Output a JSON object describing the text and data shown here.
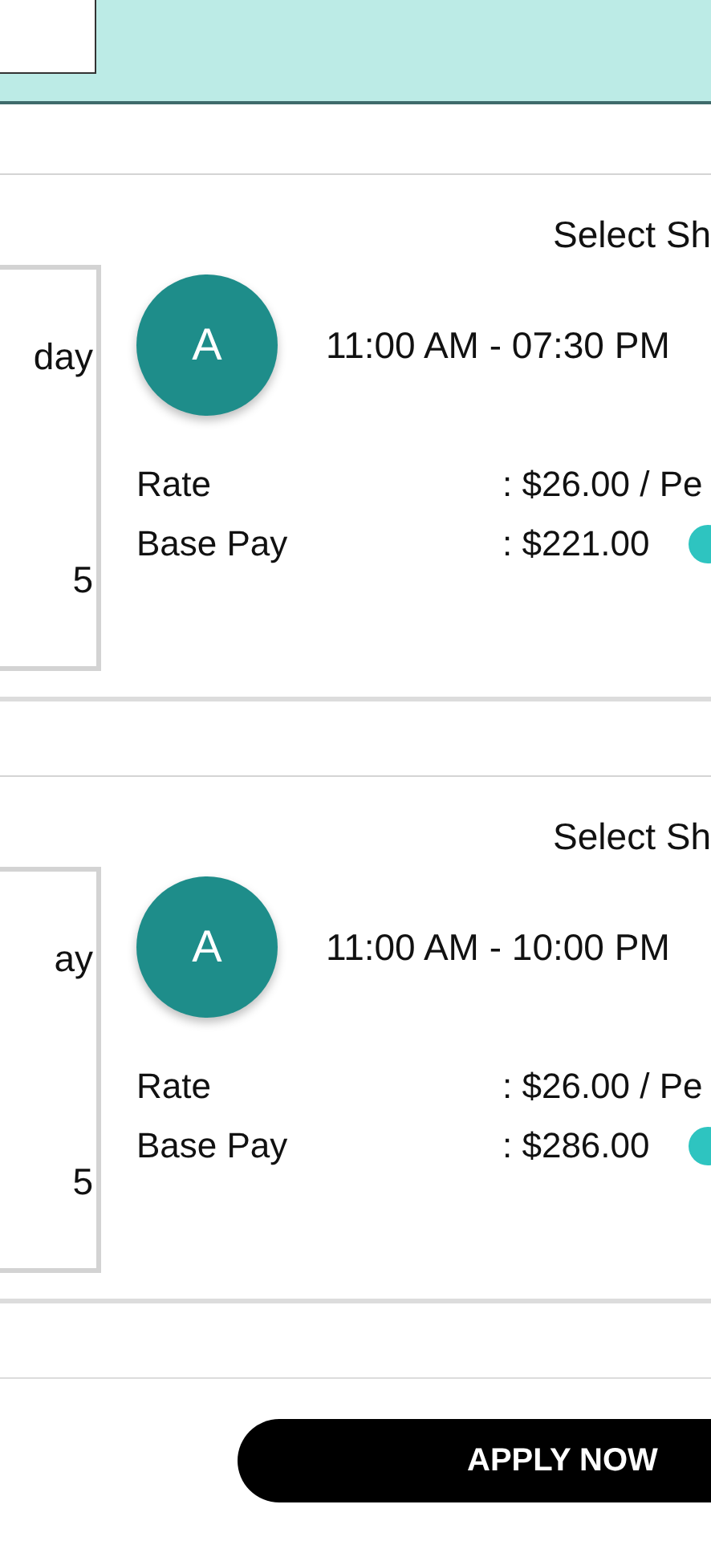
{
  "cards": [
    {
      "select_label": "Select Sh",
      "date_lines": [
        "day",
        "5"
      ],
      "avatar_letter": "A",
      "time_range": "11:00 AM - 07:30 PM",
      "details": [
        {
          "label": "Rate",
          "value": ": $26.00 / Pe",
          "has_icon": false
        },
        {
          "label": "Base Pay",
          "value": ": $221.00",
          "has_icon": true
        }
      ]
    },
    {
      "select_label": "Select Sh",
      "date_lines": [
        "ay",
        "5"
      ],
      "avatar_letter": "A",
      "time_range": "11:00 AM - 10:00 PM",
      "details": [
        {
          "label": "Rate",
          "value": ": $26.00 / Pe",
          "has_icon": false
        },
        {
          "label": "Base Pay",
          "value": ": $286.00",
          "has_icon": true
        }
      ]
    }
  ],
  "apply_button": "APPLY NOW"
}
